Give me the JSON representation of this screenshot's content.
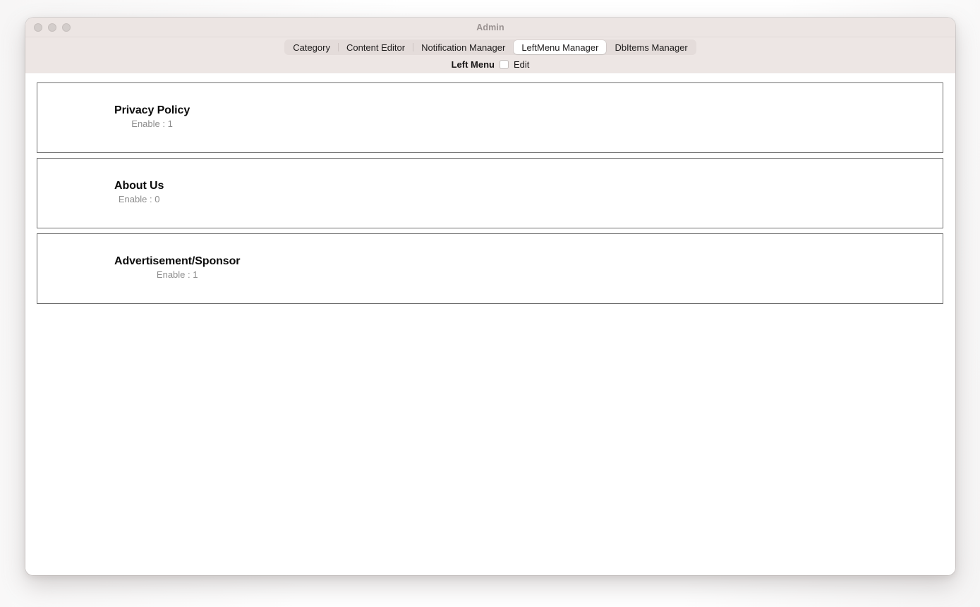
{
  "window": {
    "title": "Admin",
    "traffic_lights": [
      "close",
      "minimize",
      "zoom"
    ]
  },
  "tabs": [
    {
      "label": "Category",
      "selected": false
    },
    {
      "label": "Content Editor",
      "selected": false
    },
    {
      "label": "Notification Manager",
      "selected": false
    },
    {
      "label": "LeftMenu Manager",
      "selected": true
    },
    {
      "label": "DbItems Manager",
      "selected": false
    }
  ],
  "subheader": {
    "label": "Left Menu",
    "checkbox_label": "Edit",
    "checkbox_checked": false
  },
  "cards": [
    {
      "title": "Privacy Policy",
      "subtitle": "Enable : 1"
    },
    {
      "title": "About Us",
      "subtitle": "Enable : 0"
    },
    {
      "title": "Advertisement/Sponsor",
      "subtitle": "Enable : 1"
    }
  ],
  "colors": {
    "toolbar_bg": "#ede6e4",
    "titlebar_bg": "#ece5e3",
    "tabbar_bg": "#e4dcda",
    "selected_tab_bg": "#ffffff",
    "card_border": "#6f6f6f",
    "subtitle_text": "#8d8d8d"
  }
}
